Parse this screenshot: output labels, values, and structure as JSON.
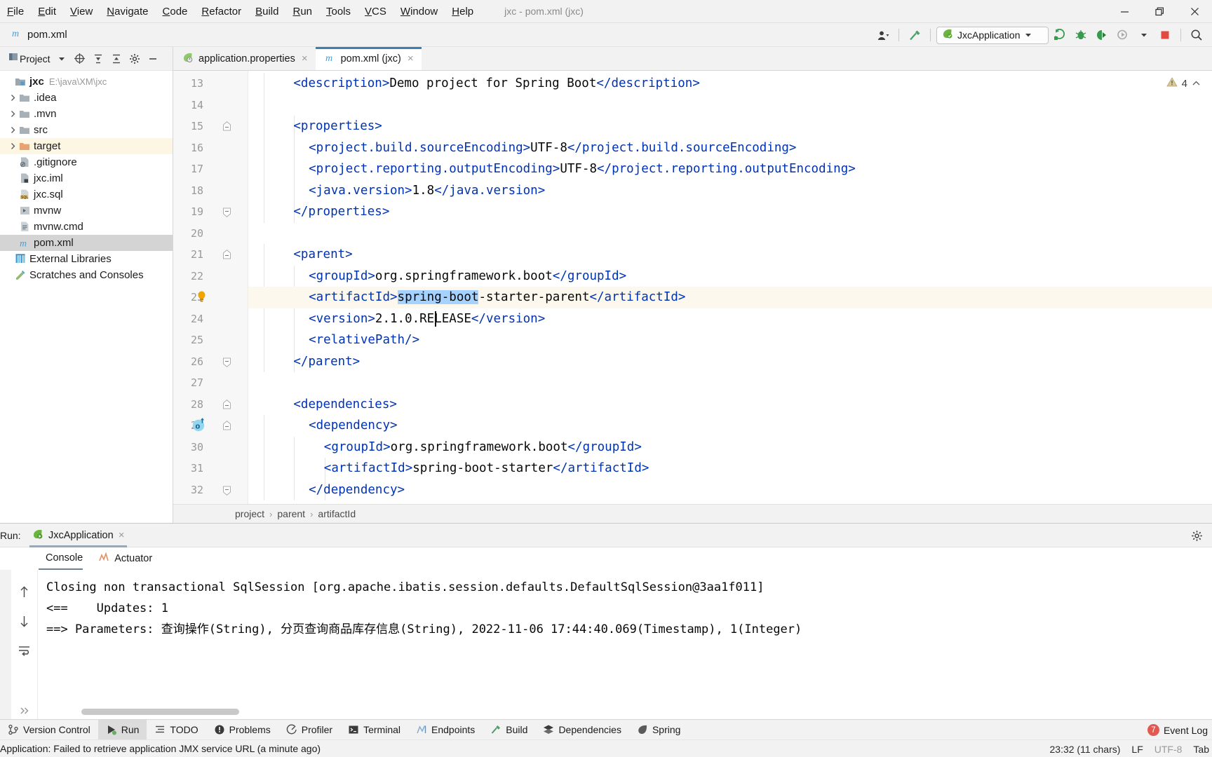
{
  "window": {
    "title": "jxc - pom.xml (jxc)",
    "controls": {
      "minimize": "minimize-icon",
      "maximize": "maximize-icon",
      "close": "close-icon"
    }
  },
  "menubar": {
    "items": [
      {
        "label": "File"
      },
      {
        "label": "Edit"
      },
      {
        "label": "View"
      },
      {
        "label": "Navigate"
      },
      {
        "label": "Code"
      },
      {
        "label": "Refactor"
      },
      {
        "label": "Build"
      },
      {
        "label": "Run"
      },
      {
        "label": "Tools"
      },
      {
        "label": "VCS"
      },
      {
        "label": "Window"
      },
      {
        "label": "Help"
      }
    ]
  },
  "navbar": {
    "file_icon": "maven-m-icon",
    "file_name": "pom.xml",
    "account_icon": "account-icon",
    "build_icon": "hammer-icon",
    "run_config": {
      "icon": "spring-boot-icon",
      "label": "JxcApplication",
      "caret": "chevron-down-icon"
    },
    "actions": [
      {
        "name": "run-icon"
      },
      {
        "name": "debug-icon"
      },
      {
        "name": "run-with-coverage-icon"
      },
      {
        "name": "profiler-icon"
      },
      {
        "name": "stop-icon"
      },
      {
        "name": "search-icon"
      }
    ]
  },
  "project": {
    "title": "Project",
    "caret": "chevron-down-icon",
    "header_icons": [
      "locate-icon",
      "expand-all-icon",
      "collapse-all-icon",
      "settings-icon",
      "hide-icon"
    ],
    "tree": [
      {
        "label": "jxc",
        "sub": "E:\\java\\XM\\jxc",
        "icon": "module-icon",
        "indent": 0,
        "twisty": "",
        "bold": true,
        "state": "normal"
      },
      {
        "label": ".idea",
        "sub": "",
        "icon": "folder-icon",
        "indent": 1,
        "twisty": "collapsed",
        "bold": false,
        "state": "normal"
      },
      {
        "label": ".mvn",
        "sub": "",
        "icon": "folder-icon",
        "indent": 1,
        "twisty": "collapsed",
        "bold": false,
        "state": "normal"
      },
      {
        "label": "src",
        "sub": "",
        "icon": "folder-icon",
        "indent": 1,
        "twisty": "collapsed",
        "bold": false,
        "state": "normal"
      },
      {
        "label": "target",
        "sub": "",
        "icon": "folder-orange-icon",
        "indent": 1,
        "twisty": "collapsed",
        "bold": false,
        "state": "highlight"
      },
      {
        "label": ".gitignore",
        "sub": "",
        "icon": "gitignore-file-icon",
        "indent": 1,
        "twisty": "",
        "bold": false,
        "state": "normal"
      },
      {
        "label": "jxc.iml",
        "sub": "",
        "icon": "iml-file-icon",
        "indent": 1,
        "twisty": "",
        "bold": false,
        "state": "normal"
      },
      {
        "label": "jxc.sql",
        "sub": "",
        "icon": "sql-file-icon",
        "indent": 1,
        "twisty": "",
        "bold": false,
        "state": "normal"
      },
      {
        "label": "mvnw",
        "sub": "",
        "icon": "script-file-icon",
        "indent": 1,
        "twisty": "",
        "bold": false,
        "state": "normal"
      },
      {
        "label": "mvnw.cmd",
        "sub": "",
        "icon": "cmd-file-icon",
        "indent": 1,
        "twisty": "",
        "bold": false,
        "state": "normal"
      },
      {
        "label": "pom.xml",
        "sub": "",
        "icon": "maven-m-icon",
        "indent": 1,
        "twisty": "",
        "bold": false,
        "state": "selected"
      },
      {
        "label": "External Libraries",
        "sub": "",
        "icon": "libraries-icon",
        "indent": 0,
        "twisty": "",
        "bold": false,
        "state": "normal"
      },
      {
        "label": "Scratches and Consoles",
        "sub": "",
        "icon": "scratches-icon",
        "indent": 0,
        "twisty": "",
        "bold": false,
        "state": "normal"
      }
    ]
  },
  "editor": {
    "tabs": [
      {
        "label": "application.properties",
        "icon": "spring-properties-icon",
        "active": false,
        "close": "×"
      },
      {
        "label": "pom.xml (jxc)",
        "icon": "maven-m-icon",
        "active": true,
        "close": "×"
      }
    ],
    "inspection": {
      "icon": "warning-triangle-icon",
      "count": "4",
      "caret": "chevron-up-icon"
    },
    "first_line_number": 13,
    "lines": [
      {
        "n": 13,
        "indent": 2,
        "fold": "",
        "marker": "",
        "current": false,
        "segs": [
          {
            "t": "<description>",
            "c": "tag"
          },
          {
            "t": "Demo project for Spring Boot",
            "c": "txt"
          },
          {
            "t": "</description>",
            "c": "tag"
          }
        ]
      },
      {
        "n": 14,
        "indent": 0,
        "fold": "",
        "marker": "",
        "current": false,
        "segs": []
      },
      {
        "n": 15,
        "indent": 2,
        "fold": "open",
        "marker": "",
        "current": false,
        "segs": [
          {
            "t": "<properties>",
            "c": "tag"
          }
        ]
      },
      {
        "n": 16,
        "indent": 3,
        "fold": "",
        "marker": "",
        "current": false,
        "segs": [
          {
            "t": "<project.build.sourceEncoding>",
            "c": "tag"
          },
          {
            "t": "UTF-8",
            "c": "txt"
          },
          {
            "t": "</project.build.sourceEncoding>",
            "c": "tag"
          }
        ]
      },
      {
        "n": 17,
        "indent": 3,
        "fold": "",
        "marker": "",
        "current": false,
        "segs": [
          {
            "t": "<project.reporting.outputEncoding>",
            "c": "tag"
          },
          {
            "t": "UTF-8",
            "c": "txt"
          },
          {
            "t": "</project.reporting.outputEncoding>",
            "c": "tag"
          }
        ]
      },
      {
        "n": 18,
        "indent": 3,
        "fold": "",
        "marker": "",
        "current": false,
        "segs": [
          {
            "t": "<java.version>",
            "c": "tag"
          },
          {
            "t": "1.8",
            "c": "txt"
          },
          {
            "t": "</java.version>",
            "c": "tag"
          }
        ]
      },
      {
        "n": 19,
        "indent": 2,
        "fold": "close",
        "marker": "",
        "current": false,
        "segs": [
          {
            "t": "</properties>",
            "c": "tag"
          }
        ]
      },
      {
        "n": 20,
        "indent": 0,
        "fold": "",
        "marker": "",
        "current": false,
        "segs": []
      },
      {
        "n": 21,
        "indent": 2,
        "fold": "open",
        "marker": "",
        "current": false,
        "segs": [
          {
            "t": "<parent>",
            "c": "tag"
          }
        ]
      },
      {
        "n": 22,
        "indent": 3,
        "fold": "",
        "marker": "",
        "current": false,
        "segs": [
          {
            "t": "<groupId>",
            "c": "tag"
          },
          {
            "t": "org.springframework.boot",
            "c": "txt"
          },
          {
            "t": "</groupId>",
            "c": "tag"
          }
        ]
      },
      {
        "n": 23,
        "indent": 3,
        "fold": "",
        "marker": "bulb",
        "current": true,
        "segs": [
          {
            "t": "<artifactId>",
            "c": "tag"
          },
          {
            "t": "spring-boot",
            "c": "sel"
          },
          {
            "t": "-starter-parent",
            "c": "txt"
          },
          {
            "t": "</artifactId>",
            "c": "tag"
          }
        ]
      },
      {
        "n": 24,
        "indent": 3,
        "fold": "",
        "marker": "",
        "current": false,
        "segs": [
          {
            "t": "<version>",
            "c": "tag"
          },
          {
            "t": "2.1.0.RELEASE",
            "c": "txt"
          },
          {
            "t": "</version>",
            "c": "tag"
          }
        ]
      },
      {
        "n": 25,
        "indent": 3,
        "fold": "",
        "marker": "",
        "current": false,
        "segs": [
          {
            "t": "<relativePath/>",
            "c": "tag"
          }
        ]
      },
      {
        "n": 26,
        "indent": 2,
        "fold": "close",
        "marker": "",
        "current": false,
        "segs": [
          {
            "t": "</parent>",
            "c": "tag"
          }
        ]
      },
      {
        "n": 27,
        "indent": 0,
        "fold": "",
        "marker": "",
        "current": false,
        "segs": []
      },
      {
        "n": 28,
        "indent": 2,
        "fold": "open",
        "marker": "",
        "current": false,
        "segs": [
          {
            "t": "<dependencies>",
            "c": "tag"
          }
        ]
      },
      {
        "n": 29,
        "indent": 3,
        "fold": "open",
        "marker": "bookmark",
        "current": false,
        "segs": [
          {
            "t": "<dependency>",
            "c": "tag"
          }
        ]
      },
      {
        "n": 30,
        "indent": 4,
        "fold": "",
        "marker": "",
        "current": false,
        "segs": [
          {
            "t": "<groupId>",
            "c": "tag"
          },
          {
            "t": "org.springframework.boot",
            "c": "txt"
          },
          {
            "t": "</groupId>",
            "c": "tag"
          }
        ]
      },
      {
        "n": 31,
        "indent": 4,
        "fold": "",
        "marker": "",
        "current": false,
        "segs": [
          {
            "t": "<artifactId>",
            "c": "tag"
          },
          {
            "t": "spring-boot-starter",
            "c": "txt"
          },
          {
            "t": "</artifactId>",
            "c": "tag"
          }
        ]
      },
      {
        "n": 32,
        "indent": 3,
        "fold": "close",
        "marker": "",
        "current": false,
        "segs": [
          {
            "t": "</dependency>",
            "c": "tag"
          }
        ]
      }
    ],
    "breadcrumb": [
      "project",
      "parent",
      "artifactId"
    ],
    "breadcrumb_sep": "›"
  },
  "run_panel": {
    "label": "Run:",
    "tab": {
      "label": "JxcApplication",
      "icon": "spring-boot-icon",
      "close": "×"
    },
    "settings_icon": "gear-icon",
    "subtabs": [
      {
        "label": "Console",
        "icon": "",
        "active": true
      },
      {
        "label": "Actuator",
        "icon": "actuator-icon",
        "active": false
      }
    ],
    "toolbar_icons": [
      "scroll-up-icon",
      "scroll-down-icon",
      "soft-wrap-icon",
      "expand-icon"
    ],
    "console_lines": [
      "==> Parameters: 查询操作(String), 分页查询商品库存信息(String), 2022-11-06 17:44:40.069(Timestamp), 1(Integer)",
      "<==    Updates: 1",
      "Closing non transactional SqlSession [org.apache.ibatis.session.defaults.DefaultSqlSession@3aa1f011]"
    ]
  },
  "bottombar": {
    "items": [
      {
        "label": "Version Control",
        "icon": "branch-icon",
        "active": false
      },
      {
        "label": "Run",
        "icon": "run-green-icon",
        "active": true
      },
      {
        "label": "TODO",
        "icon": "todo-icon",
        "active": false
      },
      {
        "label": "Problems",
        "icon": "problems-icon",
        "active": false
      },
      {
        "label": "Profiler",
        "icon": "profiler-icon",
        "active": false
      },
      {
        "label": "Terminal",
        "icon": "terminal-icon",
        "active": false
      },
      {
        "label": "Endpoints",
        "icon": "endpoints-icon",
        "active": false
      },
      {
        "label": "Build",
        "icon": "hammer-icon",
        "active": false
      },
      {
        "label": "Dependencies",
        "icon": "dependencies-icon",
        "active": false
      },
      {
        "label": "Spring",
        "icon": "spring-leaf-icon",
        "active": false
      }
    ],
    "event_log": {
      "count": "7",
      "label": "Event Log"
    }
  },
  "statusbar": {
    "message": "Application: Failed to retrieve application JMX service URL (a minute ago)",
    "caret_position": "23:32 (11 chars)",
    "line_separator": "LF",
    "encoding": "UTF-8",
    "indent": "Tab"
  },
  "colors": {
    "accent_blue": "#3c7fb1",
    "tag_blue": "#0033b3",
    "selection_blue": "#a6d2ff",
    "current_line": "#fdf8ee",
    "panel_gray": "#f2f2f2",
    "spring_green": "#6db33f",
    "error_red": "#e05a52",
    "target_highlight": "#fdf6e3"
  }
}
